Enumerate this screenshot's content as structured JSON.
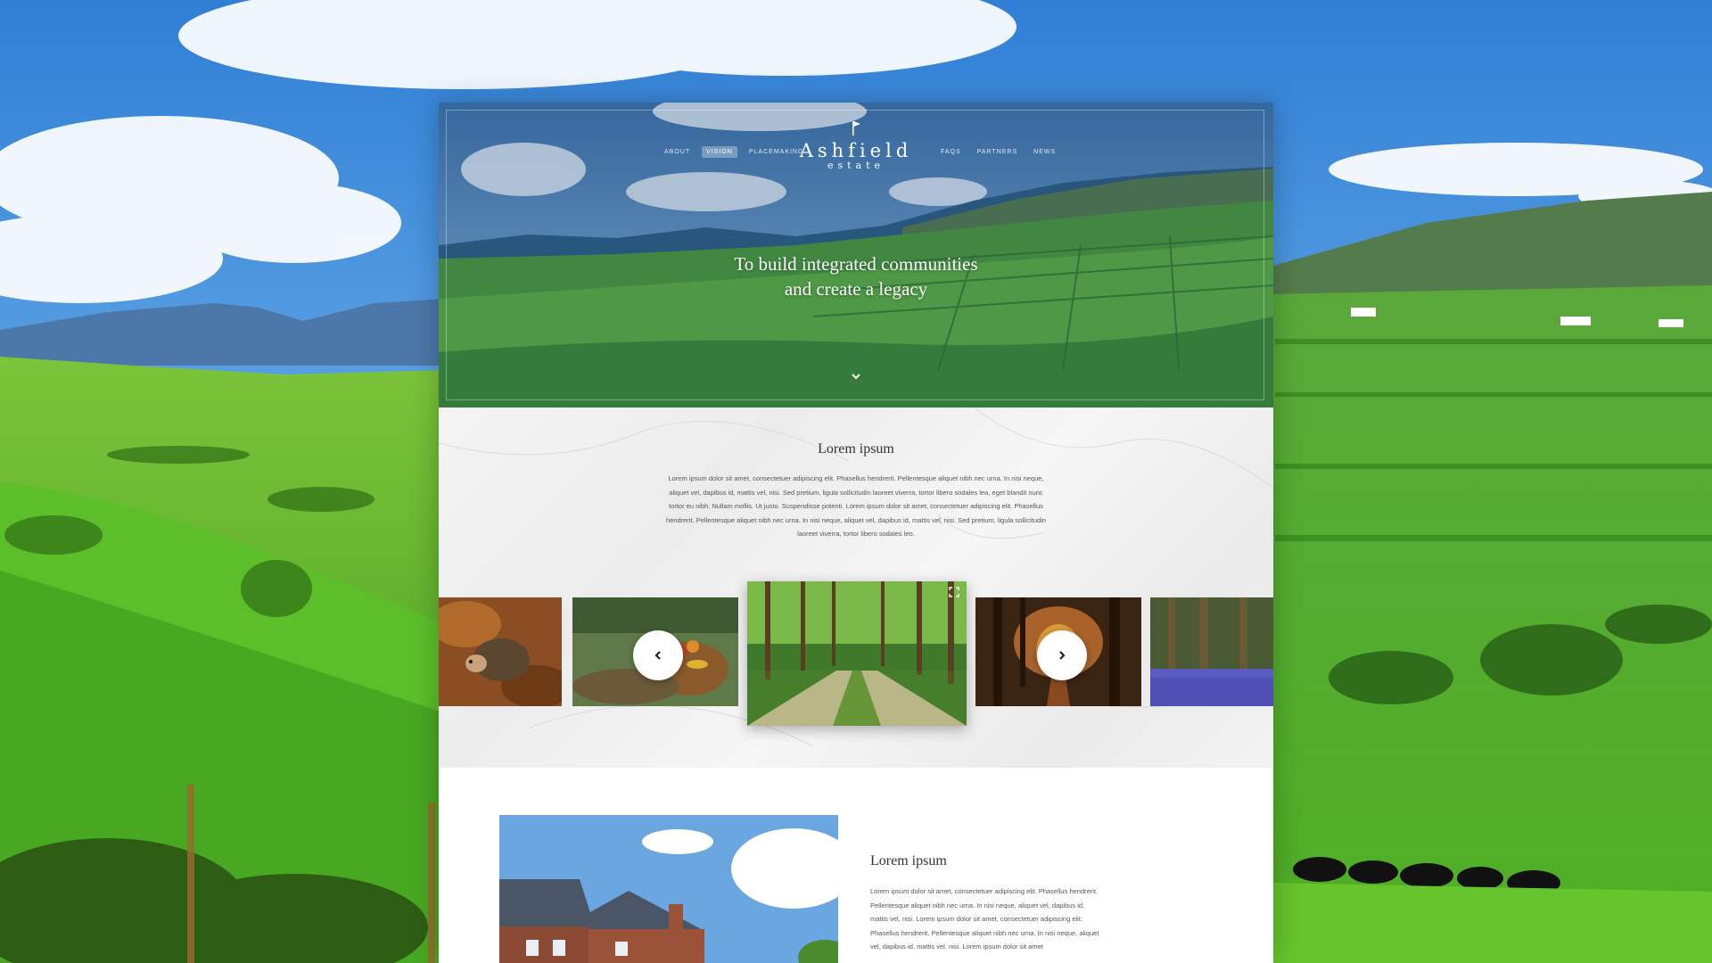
{
  "site": {
    "logo_title": "Ashfield",
    "logo_subtitle": "estate"
  },
  "nav": {
    "left": [
      {
        "label": "ABOUT",
        "active": false
      },
      {
        "label": "VISION",
        "active": true
      },
      {
        "label": "PLACEMAKING",
        "active": false
      }
    ],
    "right": [
      {
        "label": "FAQS",
        "active": false
      },
      {
        "label": "PARTNERS",
        "active": false
      },
      {
        "label": "NEWS",
        "active": false
      }
    ]
  },
  "hero": {
    "tagline_line1": "To build integrated communities",
    "tagline_line2": "and create a legacy"
  },
  "intro": {
    "title": "Lorem ipsum",
    "body": "Lorem ipsum dolor sit amet, consectetuer adipiscing elit. Phasellus hendrerit. Pellentesque aliquet nibh nec urna. In nisi neque, aliquet vel, dapibus id, mattis vel, nisi. Sed pretium, ligula sollicitudin laoreet viverra, tortor libero sodales leo, eget blandit nunc tortor eu nibh. Nullam mollis. Ut justo. Suspendisse potenti. Lorem ipsum dolor sit amet, consectetuer adipiscing elit. Phasellus hendrerit. Pellentesque aliquet nibh nec urna. In nisi neque, aliquet vel, dapibus id, mattis vel, nisi. Sed pretium, ligula sollicitudin laoreet viverra, tortor libero sodales leo."
  },
  "carousel": {
    "slides": [
      "hedgehog-photo",
      "vegetable-basket-photo",
      "forest-path-photo",
      "autumn-forest-photo",
      "bluebell-woods-photo"
    ],
    "active_index": 2
  },
  "feature": {
    "title": "Lorem ipsum",
    "body": "Lorem ipsum dolor sit amet, consectetuer adipiscing elit. Phasellus hendrerit. Pellentesque aliquet nibh nec urna. In nisi neque, aliquet vel, dapibus id, mattis vel, nisi. Lorem ipsum dolor sit amet, consectetuer adipiscing elit. Phasellus hendrerit. Pellentesque aliquet nibh nec urna. In nisi neque, aliquet vel, dapibus id, mattis vel, nisi. Lorem ipsum dolor sit amet"
  },
  "colors": {
    "sky": "#4a90d9",
    "grass": "#5cb82e",
    "overlay": "#3b6ea8"
  }
}
